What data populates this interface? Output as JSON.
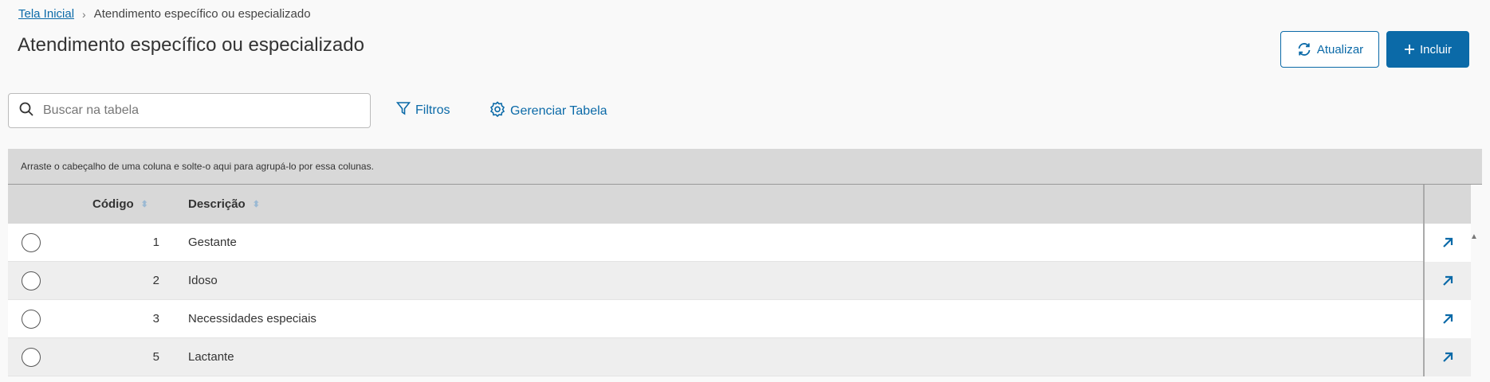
{
  "breadcrumb": {
    "home": "Tela Inicial",
    "separator": "›",
    "current": "Atendimento específico ou especializado"
  },
  "page": {
    "title": "Atendimento específico ou especializado"
  },
  "actions": {
    "refresh_label": "Atualizar",
    "add_label": "Incluir"
  },
  "search": {
    "placeholder": "Buscar na tabela",
    "value": ""
  },
  "toolbar": {
    "filters_label": "Filtros",
    "manage_label": "Gerenciar Tabela"
  },
  "grid": {
    "group_hint": "Arraste o cabeçalho de uma coluna e solte-o aqui para agrupá-lo por essa colunas.",
    "columns": {
      "code": "Código",
      "description": "Descrição"
    },
    "rows": [
      {
        "code": "1",
        "description": "Gestante"
      },
      {
        "code": "2",
        "description": "Idoso"
      },
      {
        "code": "3",
        "description": "Necessidades especiais"
      },
      {
        "code": "5",
        "description": "Lactante"
      }
    ]
  },
  "colors": {
    "accent": "#0b6aa8",
    "header_bg": "#d8d8d8"
  }
}
